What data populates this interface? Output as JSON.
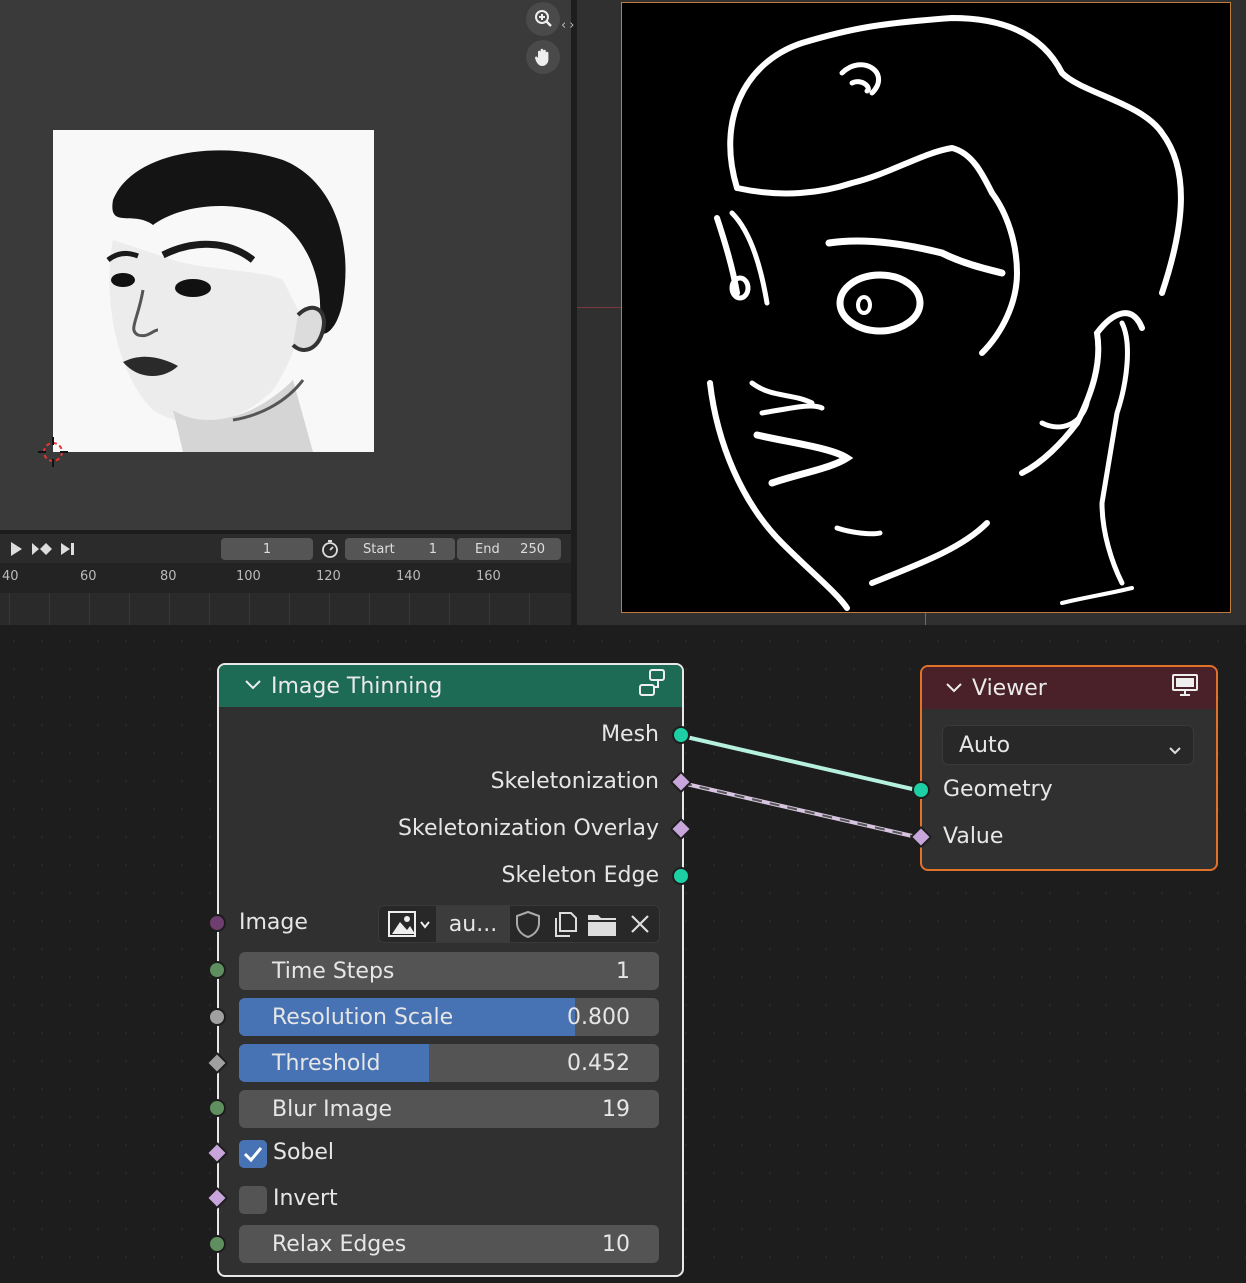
{
  "timeline": {
    "current_frame": "1",
    "start_label": "Start",
    "start_value": "1",
    "end_label": "End",
    "end_value": "250",
    "ruler": [
      "40",
      "60",
      "80",
      "100",
      "120",
      "140",
      "160"
    ]
  },
  "node_thinning": {
    "title": "Image Thinning",
    "outputs": [
      "Mesh",
      "Skeletonization",
      "Skeletonization Overlay",
      "Skeleton Edge"
    ],
    "image_label": "Image",
    "image_name": "au...",
    "time_steps": {
      "label": "Time Steps",
      "value": "1"
    },
    "resolution_scale": {
      "label": "Resolution Scale",
      "value": "0.800",
      "fill": 0.8
    },
    "threshold": {
      "label": "Threshold",
      "value": "0.452",
      "fill": 0.452
    },
    "blur_image": {
      "label": "Blur Image",
      "value": "19"
    },
    "sobel": {
      "label": "Sobel",
      "checked": true
    },
    "invert": {
      "label": "Invert",
      "checked": false
    },
    "relax_edges": {
      "label": "Relax Edges",
      "value": "10"
    }
  },
  "node_viewer": {
    "title": "Viewer",
    "dropdown_value": "Auto",
    "inputs": [
      "Geometry",
      "Value"
    ]
  },
  "colors": {
    "thinning_header": "#1e6b55",
    "viewer_header": "#4a2128",
    "viewer_border": "#e0722a",
    "slider_fill": "#4772b3",
    "geometry_socket": "#1dcfa4",
    "value_socket": "#c8a6dc"
  },
  "icons": [
    "zoom-icon",
    "hand-pan-icon",
    "play-icon",
    "jump-keyframe-icon",
    "jump-end-icon",
    "stopwatch-icon",
    "node-group-icon",
    "monitor-icon",
    "image-browse-icon",
    "shield-icon",
    "duplicate-icon",
    "folder-icon",
    "close-icon",
    "chevron-down-icon",
    "checkmark-icon"
  ]
}
